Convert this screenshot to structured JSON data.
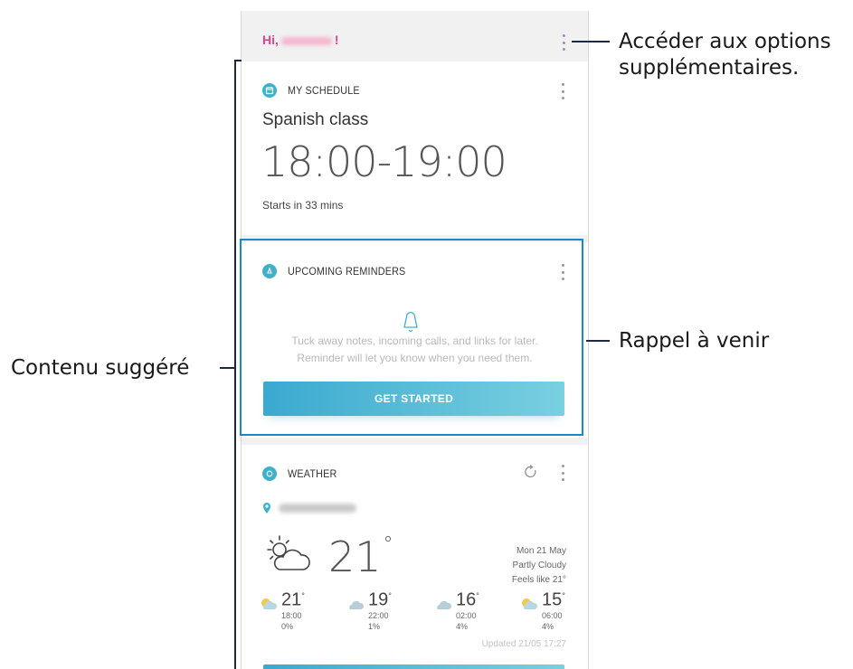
{
  "header": {
    "greeting_prefix": "Hi,",
    "greeting_suffix": "!"
  },
  "schedule_card": {
    "title": "MY SCHEDULE",
    "event_name": "Spanish class",
    "time_range": "18:00-19:00",
    "starts_in": "Starts in 33 mins"
  },
  "reminders_card": {
    "title": "UPCOMING REMINDERS",
    "description_line1": "Tuck away notes, incoming calls, and links for later.",
    "description_line2": "Reminder will let you know when you need them.",
    "button_label": "GET STARTED"
  },
  "weather_card": {
    "title": "WEATHER",
    "temperature": "21",
    "degree_symbol": "°",
    "date": "Mon 21 May",
    "condition": "Partly Cloudy",
    "feels_like": "Feels like 21°",
    "forecast": [
      {
        "temp": "21",
        "time": "18:00",
        "precip": "0%",
        "icon": "sun-cloud-icon"
      },
      {
        "temp": "19",
        "time": "22:00",
        "precip": "1%",
        "icon": "cloud-icon"
      },
      {
        "temp": "16",
        "time": "02:00",
        "precip": "4%",
        "icon": "cloud-icon"
      },
      {
        "temp": "15",
        "time": "06:00",
        "precip": "4%",
        "icon": "sun-cloud-icon"
      }
    ],
    "updated": "Updated 21/05 17:27"
  },
  "callouts": {
    "options_line1": "Accéder aux options",
    "options_line2": "supplémentaires.",
    "reminder": "Rappel à venir",
    "suggested": "Contenu suggéré"
  },
  "colors": {
    "greeting": "#e0458c",
    "accent": "#3fb2c9",
    "highlight_border": "#1a88c9",
    "callout_line": "#1a2b40"
  }
}
